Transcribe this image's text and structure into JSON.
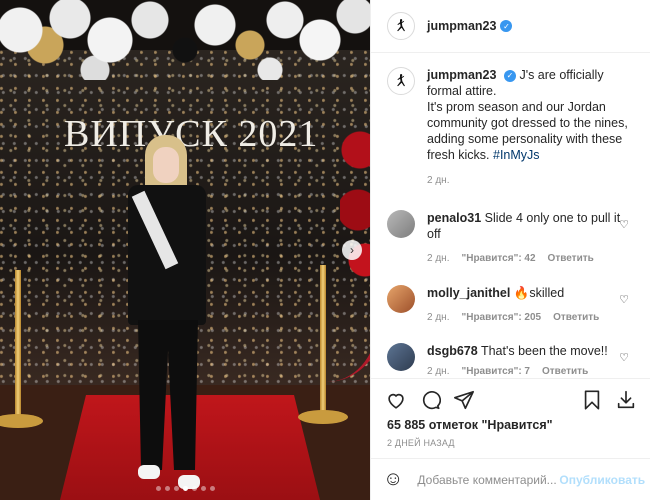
{
  "photo": {
    "banner_text": "ВИПУСК 2021",
    "carousel_count": 7,
    "carousel_active": 4
  },
  "header": {
    "username": "jumpman23"
  },
  "caption": {
    "username": "jumpman23",
    "text_line1": "J's are officially formal attire.",
    "text_body": "It's prom season and our Jordan community got dressed to the nines, adding some personality with these fresh kicks. ",
    "hashtag": "#InMyJs",
    "time": "2 дн."
  },
  "comments": [
    {
      "username": "penalo31",
      "text": "Slide 4 only one to pull it off",
      "time": "2 дн.",
      "likes": "\"Нравится\": 42",
      "reply": "Ответить"
    },
    {
      "username": "molly_janithel",
      "text": "🔥skilled",
      "time": "2 дн.",
      "likes": "\"Нравится\": 205",
      "reply": "Ответить"
    },
    {
      "username": "dsgb678",
      "text": "That's been the move!!",
      "time": "2 дн.",
      "likes": "\"Нравится\": 7",
      "reply": "Ответить"
    }
  ],
  "likes_text": "65 885 отметок \"Нравится\"",
  "posted_text": "2 ДНЕЙ НАЗАД",
  "add_comment": {
    "placeholder": "Добавьте комментарий...",
    "publish_label": "Опубликовать"
  },
  "colors": {
    "link": "#00376b",
    "verified": "#3897f0",
    "publish_disabled": "#b2dffc"
  },
  "icons": [
    "jordan-logo-icon",
    "verified-badge-icon",
    "heart-icon",
    "comment-icon",
    "share-icon",
    "bookmark-icon",
    "download-icon",
    "smile-icon",
    "chevron-right-icon"
  ]
}
